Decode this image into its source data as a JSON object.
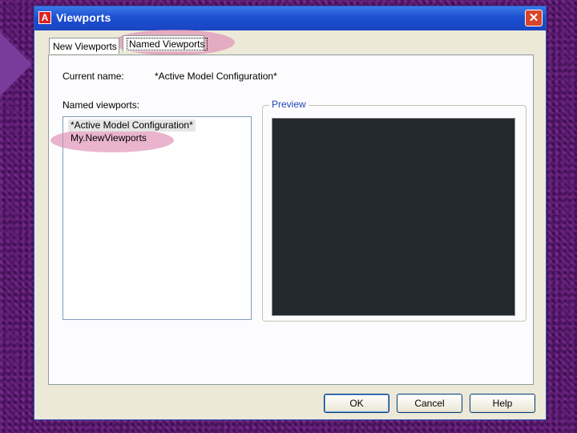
{
  "window": {
    "title": "Viewports",
    "close_glyph": "✕",
    "icon_glyph": "A"
  },
  "tabs": [
    {
      "label": "New Viewports",
      "selected": false
    },
    {
      "label": "Named Viewports",
      "selected": true
    }
  ],
  "current_name": {
    "label": "Current name:",
    "value": "*Active Model Configuration*"
  },
  "named_viewports": {
    "label": "Named viewports:",
    "items": [
      "*Active Model Configuration*",
      "My.NewViewports"
    ]
  },
  "preview": {
    "label": "Preview"
  },
  "buttons": {
    "ok": "OK",
    "cancel": "Cancel",
    "help": "Help"
  },
  "colors": {
    "highlight": "#de8cb4",
    "title_bar": "#1c4fd0",
    "preview_bg": "#23282c"
  }
}
